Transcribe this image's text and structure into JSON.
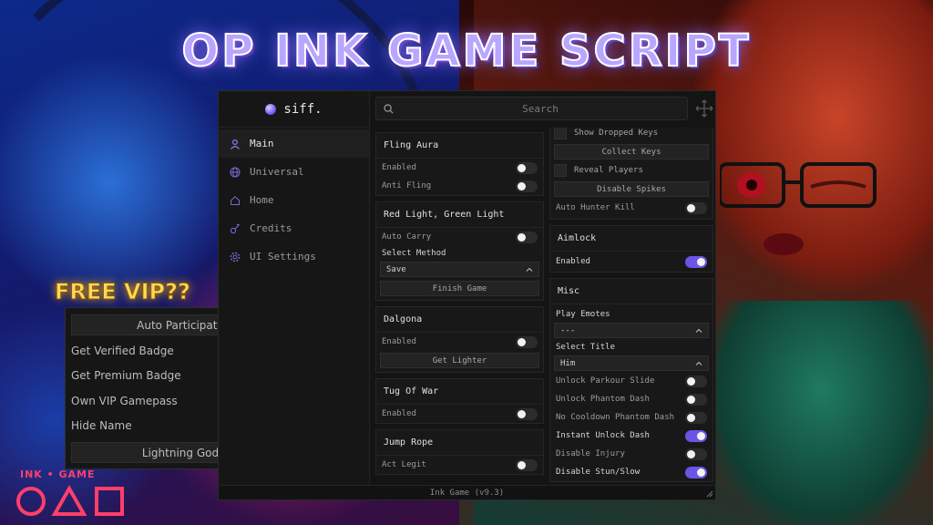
{
  "banner": {
    "title": "OP INK GAME SCRIPT",
    "free_vip": "FREE VIP??",
    "logo_text": "INK • GAME"
  },
  "window": {
    "brand": "siff.",
    "search_placeholder": "Search",
    "footer": "Ink Game (v9.3)",
    "accent_color": "#6a55e8"
  },
  "sidebar": {
    "items": [
      {
        "label": "Main",
        "icon": "user-icon",
        "active": true
      },
      {
        "label": "Universal",
        "icon": "globe-icon",
        "active": false
      },
      {
        "label": "Home",
        "icon": "home-icon",
        "active": false
      },
      {
        "label": "Credits",
        "icon": "credits-icon",
        "active": false
      },
      {
        "label": "UI Settings",
        "icon": "gear-icon",
        "active": false
      }
    ]
  },
  "col_a": {
    "fling": {
      "title": "Fling Aura",
      "enabled": "Enabled",
      "anti_fling": "Anti Fling"
    },
    "rlgl": {
      "title": "Red Light, Green Light",
      "auto_carry": "Auto Carry",
      "select_method": "Select Method",
      "method_value": "Save",
      "finish_game": "Finish Game"
    },
    "dalgona": {
      "title": "Dalgona",
      "enabled": "Enabled",
      "get_lighter": "Get Lighter"
    },
    "tug": {
      "title": "Tug Of War",
      "enabled": "Enabled"
    },
    "jump": {
      "title": "Jump Rope",
      "act_legit": "Act Legit"
    }
  },
  "col_b": {
    "top": {
      "show_dropped_keys": "Show Dropped Keys",
      "collect_keys": "Collect Keys",
      "reveal_players": "Reveal Players",
      "disable_spikes": "Disable Spikes",
      "auto_hunter_kill": "Auto Hunter Kill"
    },
    "aimlock": {
      "title": "Aimlock",
      "enabled": "Enabled"
    },
    "misc": {
      "title": "Misc",
      "play_emotes": "Play Emotes",
      "emote_value": "---",
      "select_title": "Select Title",
      "title_value": "Him",
      "unlock_parkour": "Unlock Parkour Slide",
      "unlock_phantom": "Unlock Phantom Dash",
      "no_cooldown": "No Cooldown Phantom Dash",
      "instant_unlock": "Instant Unlock Dash",
      "disable_injury": "Disable Injury",
      "disable_stun": "Disable Stun/Slow"
    }
  },
  "vip_panel": {
    "auto_participate": "Auto Participate",
    "get_verified": "Get Verified Badge",
    "get_premium": "Get Premium Badge",
    "own_vip": "Own VIP Gamepass",
    "hide_name": "Hide Name",
    "lightning_god": "Lightning God"
  }
}
